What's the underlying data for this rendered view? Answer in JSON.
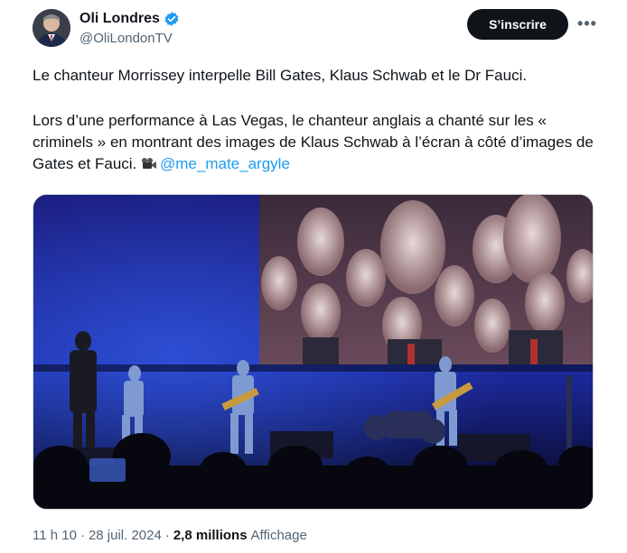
{
  "author": {
    "display_name": "Oli Londres",
    "handle": "@OliLondonTV",
    "verified": true
  },
  "actions": {
    "follow_label": "S’inscrire",
    "more_label": "•••"
  },
  "tweet": {
    "paragraph1": "Le chanteur Morrissey interpelle Bill Gates, Klaus Schwab et le Dr Fauci.",
    "paragraph2": "Lors d’une performance à Las Vegas, le chanteur anglais a chanté sur les « criminels » en montrant des images de Klaus Schwab à l’écran à côté d’images de Gates et Fauci.",
    "mention": "@me_mate_argyle",
    "emoji_icon": "movie-camera-icon"
  },
  "meta": {
    "time": "11 h 10",
    "date": "28 juil. 2024",
    "separator": "·",
    "views_count": "2,8 millions",
    "views_label": "Affichage"
  },
  "colors": {
    "accent": "#1d9bf0",
    "text": "#0f1419",
    "muted": "#536471",
    "button_bg": "#0f1419"
  }
}
